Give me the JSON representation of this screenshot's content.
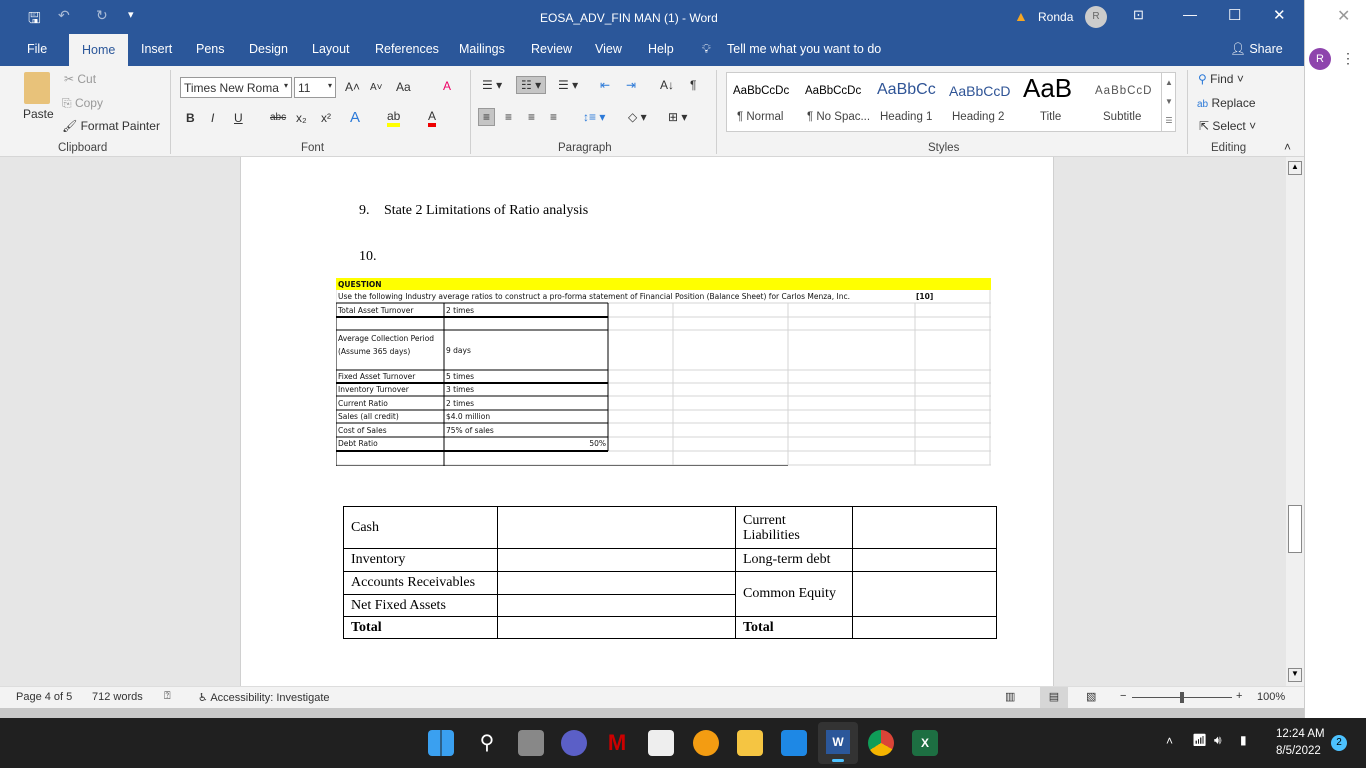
{
  "window": {
    "title": "EOSA_ADV_FIN MAN (1)  -  Word",
    "user": "Ronda",
    "user_initial": "R",
    "accent": "#2b579a"
  },
  "tabs": [
    "File",
    "Home",
    "Insert",
    "Pens",
    "Design",
    "Layout",
    "References",
    "Mailings",
    "Review",
    "View",
    "Help"
  ],
  "tell_me": "Tell me what you want to do",
  "share": "Share",
  "clipboard": {
    "paste": "Paste",
    "cut": "Cut",
    "copy": "Copy",
    "format_painter": "Format Painter",
    "label": "Clipboard"
  },
  "font": {
    "name": "Times New Roma",
    "size": "11",
    "label": "Font",
    "case": "Aa",
    "bold": "B",
    "italic": "I",
    "underline": "U",
    "strike": "abc",
    "sub": "x₂",
    "sup": "x²"
  },
  "paragraph": {
    "label": "Paragraph"
  },
  "styles": {
    "label": "Styles",
    "items": [
      {
        "preview": "AaBbCcDc",
        "name": "¶ Normal"
      },
      {
        "preview": "AaBbCcDc",
        "name": "¶ No Spac..."
      },
      {
        "preview": "AaBbCc",
        "name": "Heading 1"
      },
      {
        "preview": "AaBbCcD",
        "name": "Heading 2"
      },
      {
        "preview": "AaB",
        "name": "Title"
      },
      {
        "preview": "AaBbCcD",
        "name": "Subtitle"
      }
    ]
  },
  "editing": {
    "label": "Editing",
    "find": "Find",
    "replace": "Replace",
    "select": "Select"
  },
  "document": {
    "item9_num": "9.",
    "item9_text": "State 2 Limitations of Ratio analysis",
    "item10_num": "10.",
    "excel": {
      "header": "QUESTION",
      "instruction": "Use the following Industry average ratios to construct a pro-forma statement of Financial Position (Balance Sheet) for Carlos Menza, Inc.",
      "marks": "[10]",
      "rows": [
        [
          "Total Asset Turnover",
          "2 times"
        ],
        [
          "",
          ""
        ],
        [
          "Average Collection Period (Assume 365 days)",
          "9 days"
        ],
        [
          "Fixed Asset Turnover",
          "5 times"
        ],
        [
          "Inventory Turnover",
          "3 times"
        ],
        [
          "Current Ratio",
          "2 times"
        ],
        [
          "Sales (all credit)",
          "$4.0 million"
        ],
        [
          "Cost of Sales",
          "75% of sales"
        ],
        [
          "Debt Ratio",
          "50%"
        ]
      ]
    },
    "balance_sheet": {
      "cash": "Cash",
      "inventory": "Inventory",
      "receivables": "Accounts Receivables",
      "net_fixed": "Net Fixed Assets",
      "total_left": "Total",
      "current_liab": "Current Liabilities",
      "lt_debt": "Long-term debt",
      "equity": "Common Equity",
      "total_right": "Total"
    }
  },
  "status": {
    "page": "Page 4 of 5",
    "words": "712 words",
    "accessibility": "Accessibility: Investigate",
    "zoom": "100%"
  },
  "taskbar": {
    "time": "12:24 AM",
    "date": "8/5/2022",
    "notifications": "2"
  }
}
